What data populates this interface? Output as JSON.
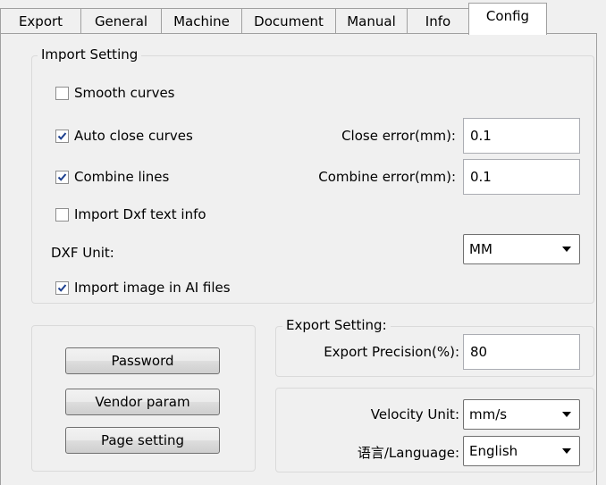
{
  "tabs": [
    {
      "label": "Export"
    },
    {
      "label": "General"
    },
    {
      "label": "Machine"
    },
    {
      "label": "Document"
    },
    {
      "label": "Manual"
    },
    {
      "label": "Info"
    },
    {
      "label": "Config",
      "active": true
    }
  ],
  "import_setting": {
    "legend": "Import Setting",
    "smooth_curves": {
      "label": "Smooth curves",
      "checked": false
    },
    "auto_close_curves": {
      "label": "Auto close curves",
      "checked": true
    },
    "close_error_label": "Close error(mm):",
    "close_error_value": "0.1",
    "combine_lines": {
      "label": "Combine lines",
      "checked": true
    },
    "combine_error_label": "Combine error(mm):",
    "combine_error_value": "0.1",
    "import_dxf_text": {
      "label": "Import Dxf text info",
      "checked": false
    },
    "dxf_unit_label": "DXF Unit:",
    "dxf_unit_value": "MM",
    "import_image_ai": {
      "label": "Import image in AI files",
      "checked": true
    }
  },
  "buttons": {
    "password": "Password",
    "vendor_param": "Vendor param",
    "page_setting": "Page setting"
  },
  "export_setting": {
    "legend": "Export Setting:",
    "precision_label": "Export Precision(%):",
    "precision_value": "80"
  },
  "units": {
    "velocity_label": "Velocity Unit:",
    "velocity_value": "mm/s",
    "language_label": "语言/Language:",
    "language_value": "English"
  },
  "icons": {
    "check": "check-mark-icon",
    "dropdown": "chevron-down-icon"
  }
}
